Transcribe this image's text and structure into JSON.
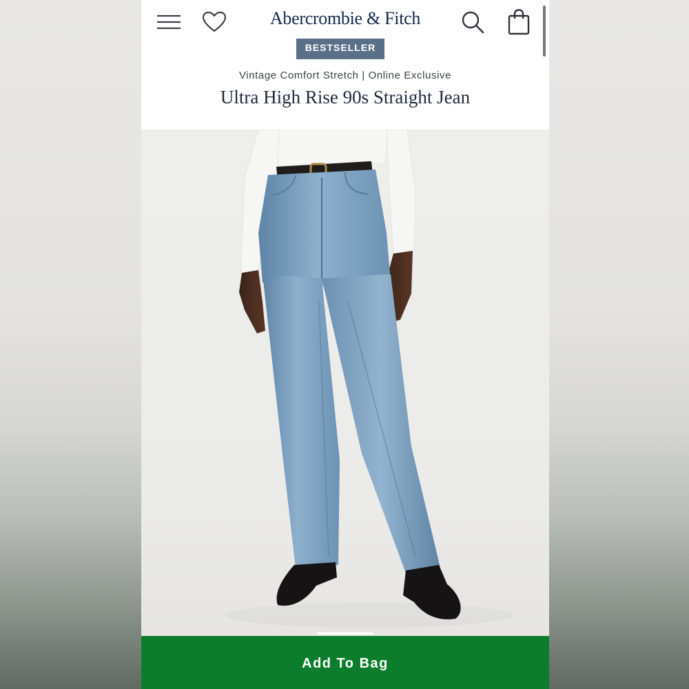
{
  "header": {
    "brand": "Abercrombie & Fitch",
    "icons": [
      "menu-icon",
      "heart-icon",
      "search-icon",
      "shopping-bag-icon"
    ]
  },
  "product": {
    "badge": "BESTSELLER",
    "subtitle": "Vintage Comfort Stretch | Online Exclusive",
    "title": "Ultra High Rise 90s Straight Jean",
    "image_alt": "Model wearing light wash straight jeans with white long sleeve top, black belt and black loafers"
  },
  "actions": {
    "add_to_bag": "Add To Bag"
  },
  "colors": {
    "brand_navy": "#122a4a",
    "badge_bg": "#5a7088",
    "cta_green": "#0c7d2c",
    "denim": "#7c9fbe"
  }
}
